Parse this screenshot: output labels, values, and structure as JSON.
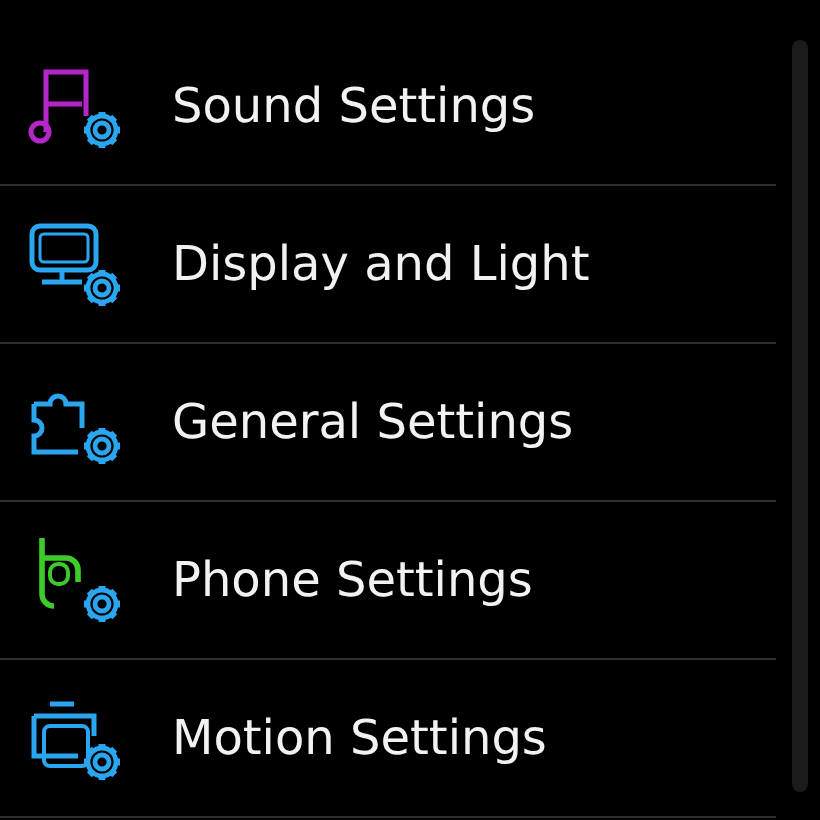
{
  "settings_menu": [
    {
      "label": "Sound Settings",
      "kind": "music"
    },
    {
      "label": "Display and Light",
      "kind": "display"
    },
    {
      "label": "General Settings",
      "kind": "puzzle"
    },
    {
      "label": "Phone Settings",
      "kind": "phone"
    },
    {
      "label": "Motion Settings",
      "kind": "camera"
    }
  ]
}
